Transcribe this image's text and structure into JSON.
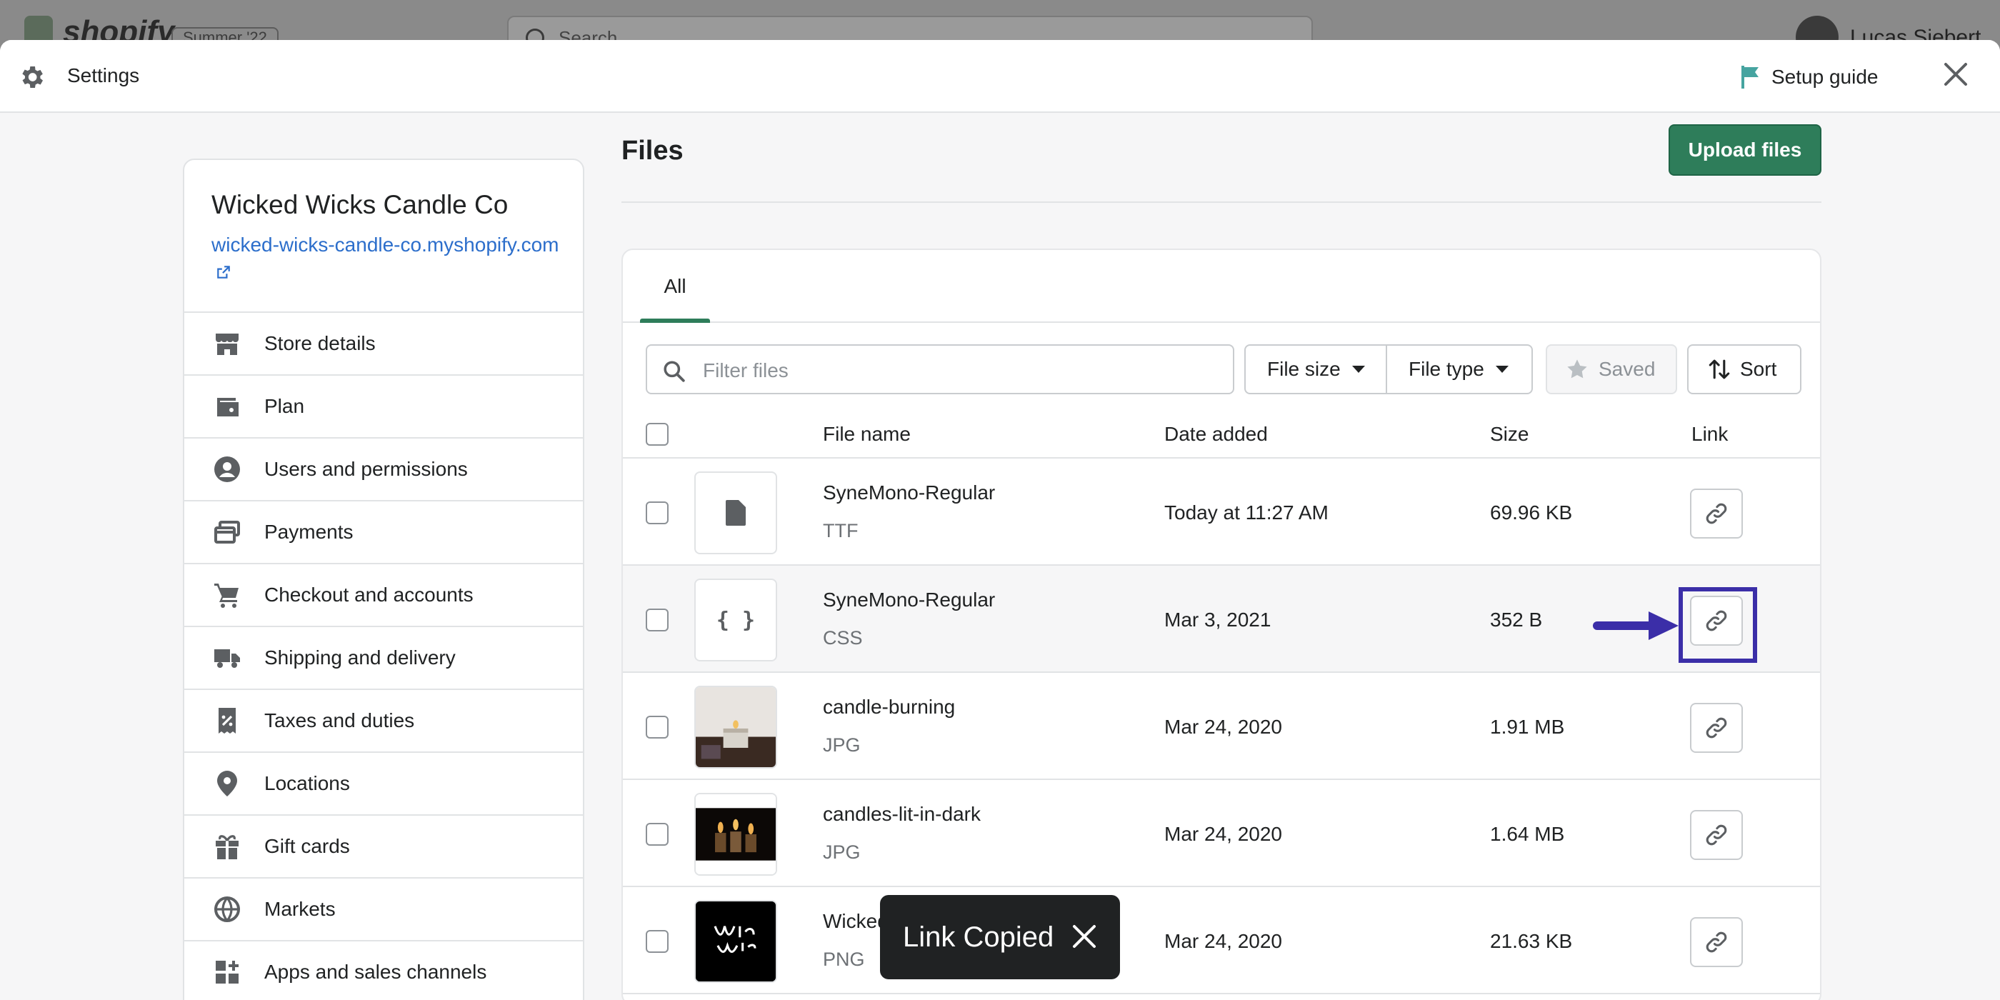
{
  "topbar": {
    "brand": "shopify",
    "badge": "Summer '22",
    "search_placeholder": "Search",
    "user_name": "Lucas Siebert"
  },
  "modal": {
    "title": "Settings",
    "setup_guide": "Setup guide",
    "accent_color": "#2e7d5a",
    "flag_color": "#46a4a0"
  },
  "store": {
    "name": "Wicked Wicks Candle Co",
    "url": "wicked-wicks-candle-co.myshopify.com"
  },
  "nav": {
    "items": [
      {
        "label": "Store details",
        "icon": "store-icon"
      },
      {
        "label": "Plan",
        "icon": "wallet-icon"
      },
      {
        "label": "Users and permissions",
        "icon": "user-circle-icon"
      },
      {
        "label": "Payments",
        "icon": "payments-icon"
      },
      {
        "label": "Checkout and accounts",
        "icon": "cart-icon"
      },
      {
        "label": "Shipping and delivery",
        "icon": "truck-icon"
      },
      {
        "label": "Taxes and duties",
        "icon": "tax-receipt-icon"
      },
      {
        "label": "Locations",
        "icon": "location-pin-icon"
      },
      {
        "label": "Gift cards",
        "icon": "gift-icon"
      },
      {
        "label": "Markets",
        "icon": "globe-icon"
      },
      {
        "label": "Apps and sales channels",
        "icon": "apps-icon"
      }
    ]
  },
  "files": {
    "title": "Files",
    "upload_label": "Upload files",
    "tab_all": "All",
    "filter_placeholder": "Filter files",
    "filters": {
      "file_size": "File size",
      "file_type": "File type",
      "saved": "Saved",
      "sort": "Sort"
    },
    "columns": {
      "name": "File name",
      "date": "Date added",
      "size": "Size",
      "link": "Link"
    },
    "rows": [
      {
        "name": "SyneMono-Regular",
        "type": "TTF",
        "date": "Today at 11:27 AM",
        "size": "69.96 KB",
        "thumb": "document-icon"
      },
      {
        "name": "SyneMono-Regular",
        "type": "CSS",
        "date": "Mar 3, 2021",
        "size": "352 B",
        "thumb": "code-braces-icon"
      },
      {
        "name": "candle-burning",
        "type": "JPG",
        "date": "Mar 24, 2020",
        "size": "1.91 MB",
        "thumb": "candle-photo"
      },
      {
        "name": "candles-lit-in-dark",
        "type": "JPG",
        "date": "Mar 24, 2020",
        "size": "1.64 MB",
        "thumb": "candles-dark-photo"
      },
      {
        "name": "Wicked",
        "type": "PNG",
        "date": "Mar 24, 2020",
        "size": "21.63 KB",
        "thumb": "logo-image"
      }
    ],
    "braces_glyph": "{ }"
  },
  "toast": {
    "text": "Link Copied"
  },
  "annotation": {
    "highlight_color": "#3b2ea8"
  }
}
